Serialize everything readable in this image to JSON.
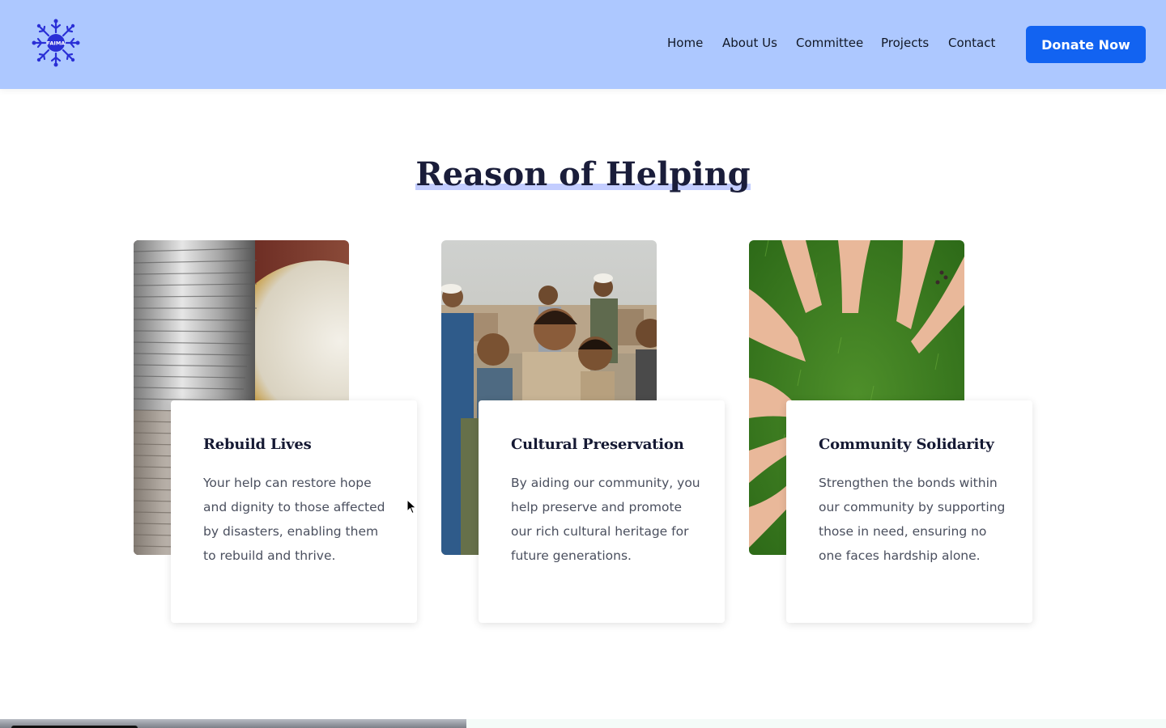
{
  "header": {
    "logo_text": "FAIMA",
    "nav": {
      "home": "Home",
      "about": "About Us",
      "committee": "Committee",
      "projects": "Projects",
      "contact": "Contact"
    },
    "donate_label": "Donate Now"
  },
  "section": {
    "title": "Reason of Helping"
  },
  "cards": [
    {
      "title": "Rebuild Lives",
      "text": "Your help can restore hope and dignity to those affected by disasters, enabling them to rebuild and thrive."
    },
    {
      "title": "Cultural Preservation",
      "text": "By aiding our community, you help preserve and promote our rich cultural heritage for future generations."
    },
    {
      "title": "Community Solidarity",
      "text": "Strengthen the bonds within our community by supporting those in need, ensuring no one faces hardship alone."
    }
  ],
  "colors": {
    "header_bg": "#adc8ff",
    "accent": "#1263f1",
    "title": "#1a1d3a",
    "logo": "#2a2fd6"
  },
  "icons": {
    "logo": "snowflake-people-logo-icon",
    "cursor": "mouse-pointer-icon"
  }
}
